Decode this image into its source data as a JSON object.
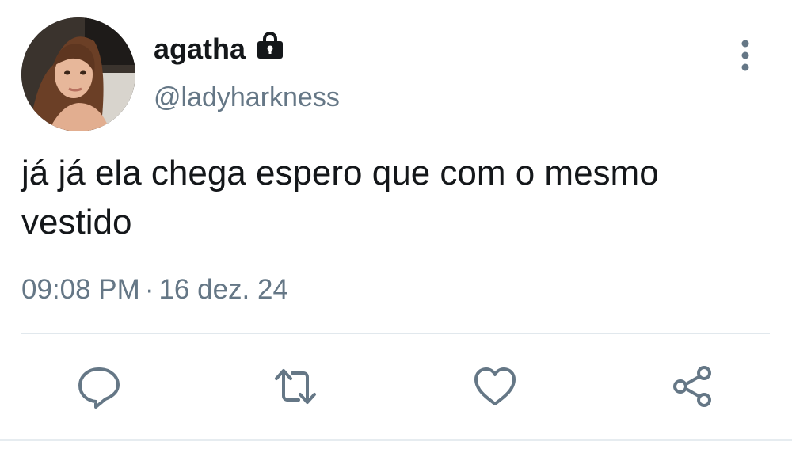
{
  "user": {
    "display_name": "agatha",
    "handle": "@ladyharkness",
    "protected_icon": "lock-icon",
    "avatar": "profile-photo"
  },
  "tweet": {
    "text": "já já ela chega espero que com o mesmo vestido",
    "time": "09:08 PM",
    "separator": "·",
    "date": "16 dez. 24"
  },
  "actions": [
    {
      "name": "reply",
      "icon": "reply-icon"
    },
    {
      "name": "retweet",
      "icon": "retweet-icon"
    },
    {
      "name": "like",
      "icon": "heart-icon"
    },
    {
      "name": "share",
      "icon": "share-icon"
    }
  ],
  "menu_icon": "more-vertical-icon",
  "colors": {
    "text": "#14171a",
    "secondary": "#657786",
    "icon": "#657786",
    "divider": "#e1e8ed"
  }
}
